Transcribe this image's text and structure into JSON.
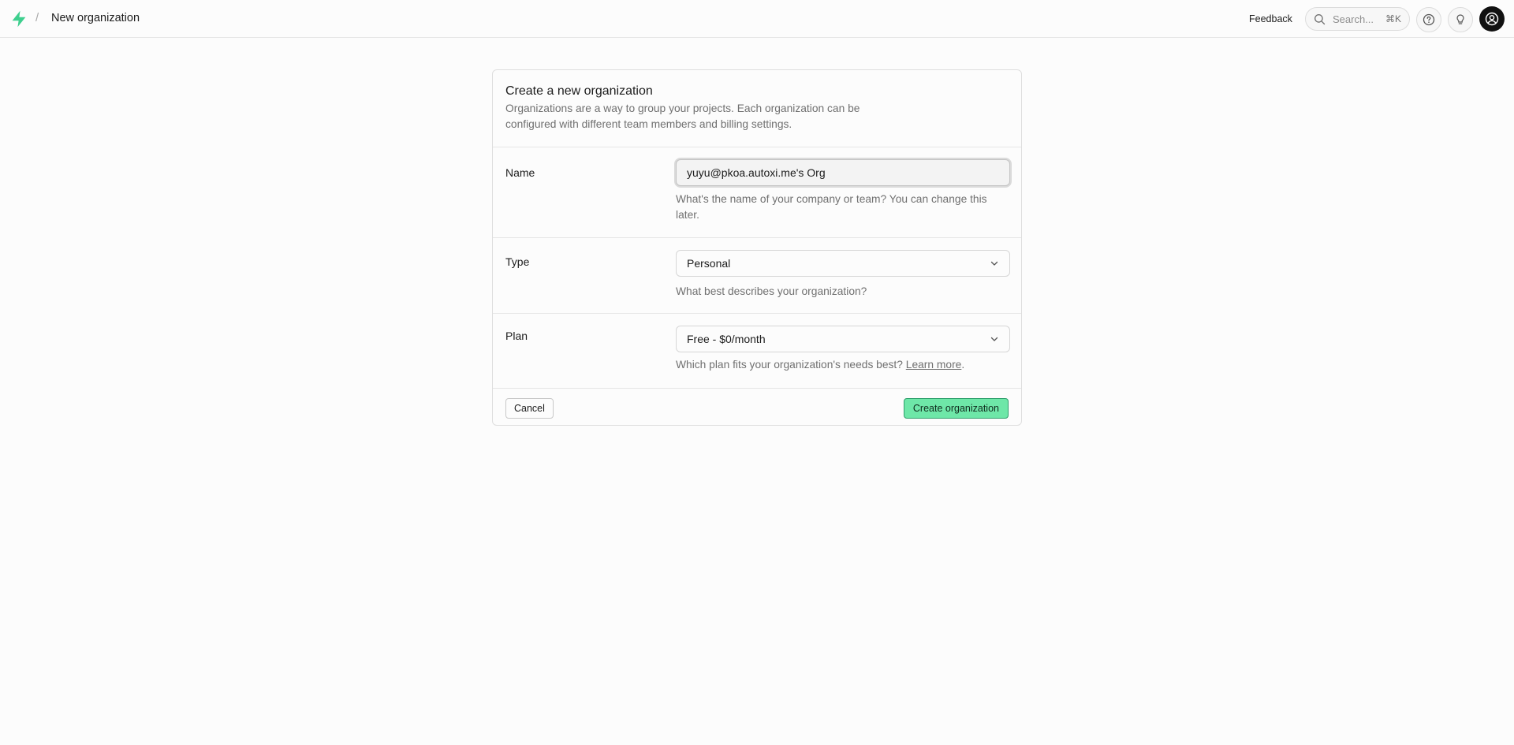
{
  "colors": {
    "brand": "#3ecf8e",
    "primary_button": "#6ee7a8",
    "border": "#dedede",
    "muted_text": "#707070"
  },
  "header": {
    "logo_icon": "supabase-bolt-icon",
    "separator": "/",
    "title": "New organization",
    "feedback_label": "Feedback",
    "search": {
      "placeholder": "Search...",
      "shortcut": "⌘K"
    },
    "help_icon": "question-circle-icon",
    "tips_icon": "lightbulb-icon",
    "avatar_icon": "user-avatar-icon"
  },
  "card": {
    "title": "Create a new organization",
    "description": "Organizations are a way to group your projects. Each organization can be configured with different team members and billing settings.",
    "name": {
      "label": "Name",
      "value": "yuyu@pkoa.autoxi.me's Org",
      "help": "What's the name of your company or team? You can change this later."
    },
    "type": {
      "label": "Type",
      "value": "Personal",
      "help": "What best describes your organization?"
    },
    "plan": {
      "label": "Plan",
      "value": "Free - $0/month",
      "help": "Which plan fits your organization's needs best?",
      "learn_more": "Learn more",
      "help_suffix": "."
    },
    "cancel_label": "Cancel",
    "create_label": "Create organization"
  }
}
